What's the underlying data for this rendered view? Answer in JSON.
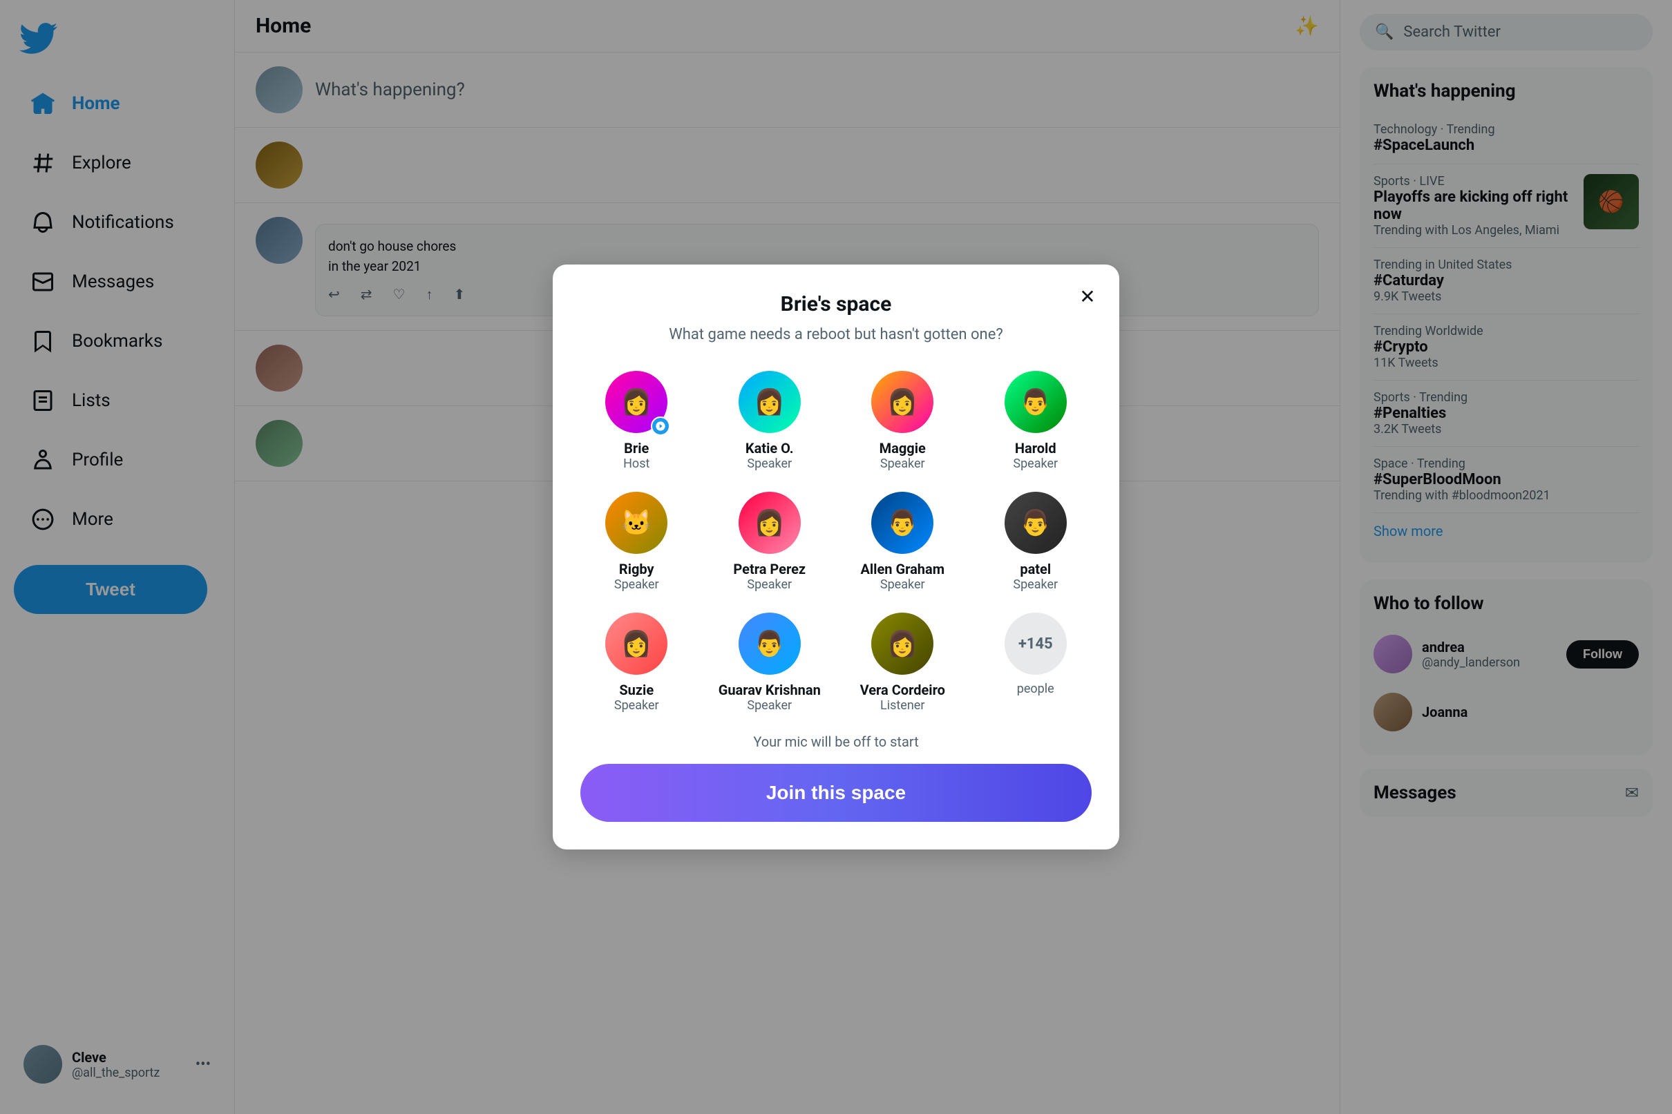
{
  "sidebar": {
    "logo_aria": "Twitter home",
    "nav_items": [
      {
        "id": "home",
        "label": "Home",
        "active": true
      },
      {
        "id": "explore",
        "label": "Explore",
        "active": false
      },
      {
        "id": "notifications",
        "label": "Notifications",
        "active": false
      },
      {
        "id": "messages",
        "label": "Messages",
        "active": false
      },
      {
        "id": "bookmarks",
        "label": "Bookmarks",
        "active": false
      },
      {
        "id": "lists",
        "label": "Lists",
        "active": false
      },
      {
        "id": "profile",
        "label": "Profile",
        "active": false
      },
      {
        "id": "more",
        "label": "More",
        "active": false
      }
    ],
    "tweet_button": "Tweet",
    "user": {
      "name": "Cleve",
      "handle": "@all_the_sportz"
    }
  },
  "main": {
    "header_title": "Home",
    "compose_placeholder": "What's happening?"
  },
  "right_sidebar": {
    "search_placeholder": "Search Twitter",
    "whats_happening_title": "What's happening",
    "trending_items": [
      {
        "category": "Technology · Trending",
        "name": "#SpaceLaunch",
        "count": null,
        "has_image": false
      },
      {
        "category": "Sports · LIVE",
        "name": "Playoffs are kicking off right now",
        "count": "Trending with Los Angeles, Miami",
        "has_image": true
      },
      {
        "category": "Trending in United States",
        "name": "#Caturday",
        "count": "9.9K Tweets",
        "has_image": false
      },
      {
        "category": "Trending Worldwide",
        "name": "#Crypto",
        "count": "11K Tweets",
        "has_image": false
      },
      {
        "category": "Sports · Trending",
        "name": "#Penalties",
        "count": "3.2K Tweets",
        "has_image": false
      },
      {
        "category": "Space · Trending",
        "name": "#SuperBloodMoon",
        "count": "Trending with #bloodmoon2021",
        "has_image": false
      }
    ],
    "show_more": "Show more",
    "who_to_follow_title": "Who to follow",
    "follow_items": [
      {
        "name": "andrea",
        "handle": "@andy_landerson"
      },
      {
        "name": "Joanna",
        "handle": ""
      }
    ],
    "follow_button": "Follow",
    "messages_title": "Messages"
  },
  "modal": {
    "title": "Brie's space",
    "subtitle": "What game needs a reboot but hasn't gotten one?",
    "close_button": "×",
    "speakers": [
      {
        "id": "brie",
        "name": "Brie",
        "role": "Host",
        "is_host": true,
        "emoji": "👩"
      },
      {
        "id": "katie",
        "name": "Katie O.",
        "role": "Speaker",
        "is_host": false,
        "emoji": "👩"
      },
      {
        "id": "maggie",
        "name": "Maggie",
        "role": "Speaker",
        "is_host": false,
        "emoji": "👩"
      },
      {
        "id": "harold",
        "name": "Harold",
        "role": "Speaker",
        "is_host": false,
        "emoji": "👨"
      },
      {
        "id": "rigby",
        "name": "Rigby",
        "role": "Speaker",
        "is_host": false,
        "emoji": "🐱"
      },
      {
        "id": "petra",
        "name": "Petra Perez",
        "role": "Speaker",
        "is_host": false,
        "emoji": "👩"
      },
      {
        "id": "allen",
        "name": "Allen Graham",
        "role": "Speaker",
        "is_host": false,
        "emoji": "👨"
      },
      {
        "id": "patel",
        "name": "patel",
        "role": "Speaker",
        "is_host": false,
        "emoji": "👨"
      },
      {
        "id": "suzie",
        "name": "Suzie",
        "role": "Speaker",
        "is_host": false,
        "emoji": "👩"
      },
      {
        "id": "guarav",
        "name": "Guarav Krishnan",
        "role": "Speaker",
        "is_host": false,
        "emoji": "👨"
      },
      {
        "id": "vera",
        "name": "Vera Cordeiro",
        "role": "Listener",
        "is_host": false,
        "emoji": "👩"
      },
      {
        "id": "more",
        "name": "+145",
        "role": "people",
        "is_host": false,
        "emoji": null
      }
    ],
    "mic_notice": "Your mic will be off to start",
    "join_button": "Join this space"
  }
}
